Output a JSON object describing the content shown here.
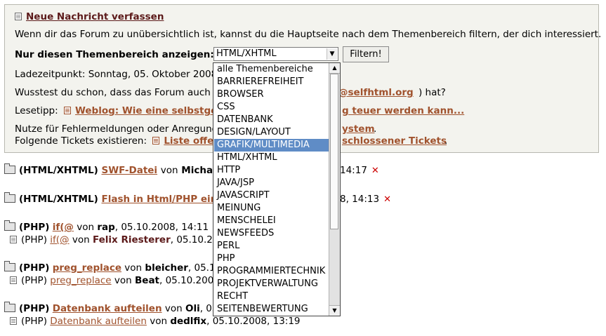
{
  "header": {
    "new_message_link": "Neue Nachricht verfassen",
    "intro_text": "Wenn dir das Forum zu unübersichtlich ist, kannst du die Hauptseite nach dem Themenbereich filtern, der dich interessiert.",
    "filter_label": "Nur diesen Themenbereich anzeigen:",
    "filter_selected": "HTML/XHTML",
    "filter_button": "Filtern!",
    "load_time": "Ladezeitpunkt: Sonntag, 05. Oktober 2008",
    "did_you_know_prefix": "Wusstest du schon, dass das Forum auch",
    "did_you_know_link": "@selfhtml.org",
    "did_you_know_suffix": ") hat?",
    "tip_prefix": "Lesetipp:",
    "tip_link_start": "Weblog: Wie eine selbstge",
    "tip_link_end": "g teuer werden kann...",
    "bug_text": "Nutze für Fehlermeldungen oder Anregung",
    "bug_link": "ystem",
    "bug_dot": ".",
    "tickets_prefix": "Folgende Tickets existieren:",
    "tickets_link_a": "Liste offe",
    "tickets_link_b": "schlossener Tickets",
    "tickets_dot": "."
  },
  "dropdown": {
    "options": [
      "alle Themenbereiche",
      "BARRIEREFREIHEIT",
      "BROWSER",
      "CSS",
      "DATENBANK",
      "DESIGN/LAYOUT",
      "GRAFIK/MULTIMEDIA",
      "HTML/XHTML",
      "HTTP",
      "JAVA/JSP",
      "JAVASCRIPT",
      "MEINUNG",
      "MENSCHELEI",
      "NEWSFEEDS",
      "PERL",
      "PHP",
      "PROGRAMMIERTECHNIK",
      "PROJEKTVERWALTUNG",
      "RECHT",
      "SEITENBEWERTUNG"
    ],
    "highlighted_index": 6
  },
  "threads": [
    {
      "topic": "(HTML/XHTML)",
      "title": "SWF-Datei",
      "by": "von",
      "author": "Michae",
      "time": "14:17"
    },
    {
      "topic": "(HTML/XHTML)",
      "title": "Flash in Html/PHP einb",
      "by": "",
      "author": "",
      "time": "8, 14:13"
    },
    {
      "topic": "(PHP)",
      "title": "if(@",
      "by": "von",
      "author": "rap",
      "time": ", 05.10.2008, 14:11"
    },
    {
      "topic": "(PHP)",
      "title": "preg_replace",
      "by": "von",
      "author": "bleicher",
      "time": ", 05.10"
    },
    {
      "topic": "(PHP)",
      "title": "Datenbank aufteilen",
      "by": "von",
      "author": "Oli",
      "time": ", 05."
    }
  ],
  "replies": [
    {
      "topic": "(PHP)",
      "title": "if(@",
      "by": "von",
      "author": "Felix Riesterer",
      "time": ", 05.10.2"
    },
    {
      "topic": "(PHP)",
      "title": "preg_replace",
      "by": "von",
      "author": "Beat",
      "time": ", 05.10.200"
    },
    {
      "topic": "(PHP)",
      "title": "Datenbank aufteilen",
      "by": "von",
      "author": "dedlfix",
      "time": ", 05.10.2008, 13:19"
    }
  ],
  "icons": {
    "delete": "x-icon",
    "folder": "folder-icon",
    "document": "document-icon"
  }
}
